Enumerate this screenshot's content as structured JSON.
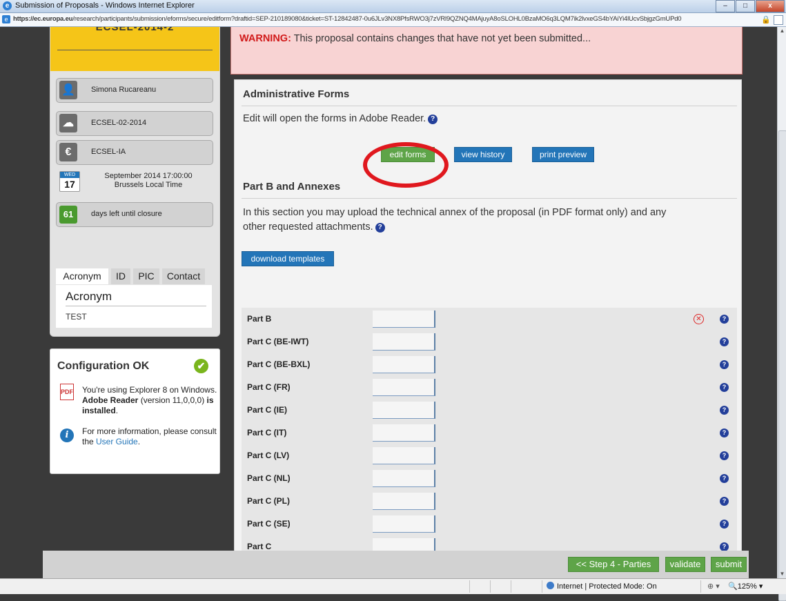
{
  "browser": {
    "title": "Submission of Proposals - Windows Internet Explorer",
    "url_host": "https://ec.europa.eu",
    "url_path": "/research/participants/submission/eforms/secure/editform?draftid=SEP-210189080&ticket=ST-12842487-0u6JLv3NX8PfsRWO3j7zVRl9QZNQ4MAjuyA8oSLOHL0BzaMO6q3LQM7ik2lvxeGS4bYAiYi4lUcvSbjgzGmUPd0",
    "status_zone": "Internet | Protected Mode: On",
    "zoom": "125%"
  },
  "sidebar": {
    "call_banner": "ECSEL-2014-2",
    "user": "Simona Rucareanu",
    "call_id": "ECSEL-02-2014",
    "action_type": "ECSEL-IA",
    "deadline": {
      "weekday": "WED",
      "day": "17",
      "text": "September 2014  17:00:00",
      "tz": "Brussels Local Time"
    },
    "days_left": {
      "count": "61",
      "label": "days left until closure"
    },
    "tabs": [
      "Acronym",
      "ID",
      "PIC",
      "Contact"
    ],
    "active_tab": "Acronym",
    "panel_heading": "Acronym",
    "panel_value": "TEST"
  },
  "config": {
    "heading": "Configuration OK",
    "msg_prefix": "You're using Explorer 8 on Windows. ",
    "msg_bold1": "Adobe Reader",
    "msg_mid": " (version 11,0,0,0) ",
    "msg_bold2": "is installed",
    "msg_end": ".",
    "info_prefix": "For more information, please consult the ",
    "info_link": "User Guide",
    "info_end": "."
  },
  "warning": {
    "label": "WARNING:",
    "text": " This proposal contains changes that have not yet been submitted..."
  },
  "admin": {
    "title": "Administrative Forms",
    "desc": "Edit will open the forms in Adobe Reader.",
    "buttons": {
      "edit": "edit forms",
      "history": "view history",
      "preview": "print preview"
    }
  },
  "partb": {
    "title": "Part B and Annexes",
    "desc_line1": "In this section you may upload the technical annex of the proposal (in PDF format only) and any",
    "desc_line2": "other requested attachments.",
    "download_btn": "download templates",
    "rows": [
      "Part B",
      "Part C (BE-IWT)",
      "Part C (BE-BXL)",
      "Part C (FR)",
      "Part C (IE)",
      "Part C (IT)",
      "Part C (LV)",
      "Part C (NL)",
      "Part C (PL)",
      "Part C (SE)",
      "Part C"
    ]
  },
  "footer": {
    "prev_step": "<< Step 4 - Parties",
    "validate": "validate",
    "submit": "submit"
  },
  "colors": {
    "green": "#5ea448",
    "blue": "#2375b8",
    "banner": "#f5c518",
    "warning_bg": "#f8d3d3",
    "highlight": "#e0181e"
  }
}
